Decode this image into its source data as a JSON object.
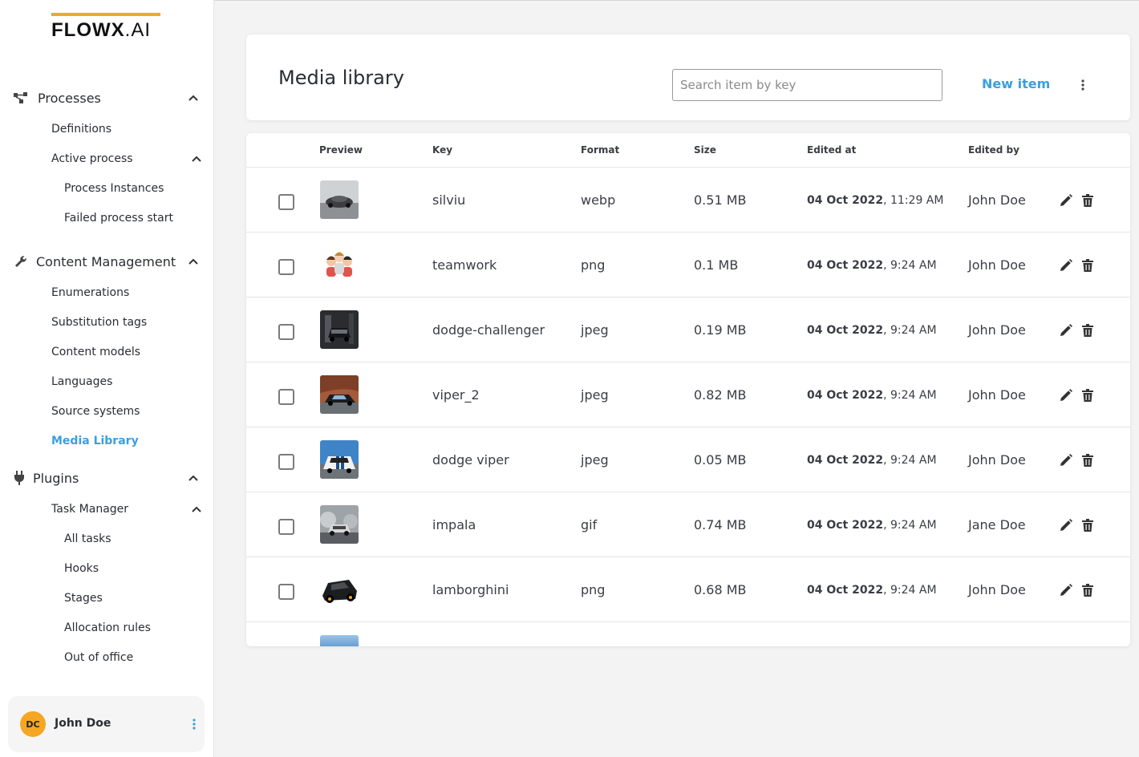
{
  "logo": {
    "main": "FLOWX",
    "suffix": ".AI"
  },
  "sidebar": {
    "groups": [
      {
        "label": "Processes",
        "icon": "process-icon",
        "items": [
          {
            "label": "Definitions"
          },
          {
            "label": "Active process",
            "children": [
              {
                "label": "Process Instances"
              },
              {
                "label": "Failed process start"
              }
            ]
          }
        ]
      },
      {
        "label": "Content Management",
        "icon": "wrench-icon",
        "items": [
          {
            "label": "Enumerations"
          },
          {
            "label": "Substitution tags"
          },
          {
            "label": "Content models"
          },
          {
            "label": "Languages"
          },
          {
            "label": "Source systems"
          },
          {
            "label": "Media Library",
            "active": true
          }
        ]
      },
      {
        "label": "Plugins",
        "icon": "plug-icon",
        "items": [
          {
            "label": "Task Manager",
            "children": [
              {
                "label": "All tasks"
              },
              {
                "label": "Hooks"
              },
              {
                "label": "Stages"
              },
              {
                "label": "Allocation rules"
              },
              {
                "label": "Out of office"
              }
            ]
          }
        ]
      }
    ],
    "user": {
      "initials": "DC",
      "name": "John Doe"
    }
  },
  "header": {
    "title": "Media library",
    "search_placeholder": "Search item by key",
    "new_item_label": "New item"
  },
  "table": {
    "columns": {
      "preview": "Preview",
      "key": "Key",
      "format": "Format",
      "size": "Size",
      "edited_at": "Edited at",
      "edited_by": "Edited by"
    },
    "rows": [
      {
        "key": "silviu",
        "format": "webp",
        "size": "0.51 MB",
        "date": "04 Oct 2022",
        "time": "11:29 AM",
        "by": "John Doe",
        "thumb": "car-gray"
      },
      {
        "key": "teamwork",
        "format": "png",
        "size": "0.1 MB",
        "date": "04 Oct 2022",
        "time": "9:24 AM",
        "by": "John Doe",
        "thumb": "people-cartoon"
      },
      {
        "key": "dodge-challenger",
        "format": "jpeg",
        "size": "0.19 MB",
        "date": "04 Oct 2022",
        "time": "9:24 AM",
        "by": "John Doe",
        "thumb": "car-dark"
      },
      {
        "key": "viper_2",
        "format": "jpeg",
        "size": "0.82 MB",
        "date": "04 Oct 2022",
        "time": "9:24 AM",
        "by": "John Doe",
        "thumb": "car-rock"
      },
      {
        "key": "dodge viper",
        "format": "jpeg",
        "size": "0.05 MB",
        "date": "04 Oct 2022",
        "time": "9:24 AM",
        "by": "John Doe",
        "thumb": "car-white-blue"
      },
      {
        "key": "impala",
        "format": "gif",
        "size": "0.74 MB",
        "date": "04 Oct 2022",
        "time": "9:24 AM",
        "by": "Jane Doe",
        "thumb": "car-smoke"
      },
      {
        "key": "lamborghini",
        "format": "png",
        "size": "0.68 MB",
        "date": "04 Oct 2022",
        "time": "9:24 AM",
        "by": "John Doe",
        "thumb": "car-black"
      }
    ]
  },
  "colors": {
    "accent": "#3a9fe0",
    "logo_bar": "#f5a623",
    "avatar": "#f5a623"
  }
}
